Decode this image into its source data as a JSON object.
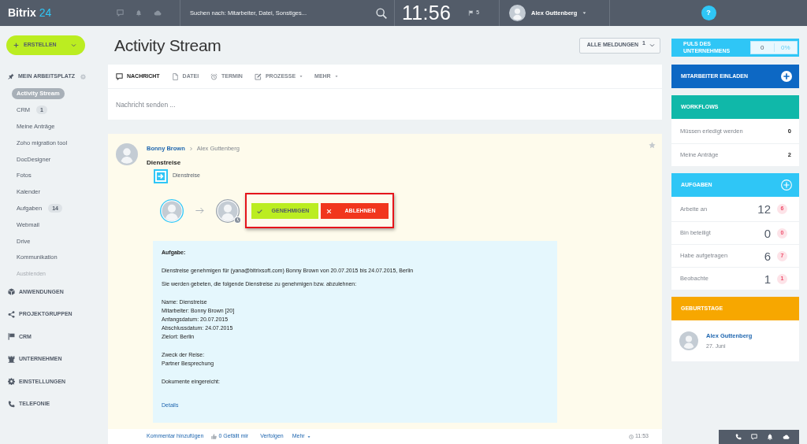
{
  "top_bar": {
    "logo": {
      "word": "Bitrix",
      "number": "24"
    },
    "search": {
      "placeholder": "Suchen nach: Mitarbeiter, Datei, Sonstiges..."
    },
    "clock": "11:56",
    "flag_count": "5",
    "user": "Alex Guttenberg",
    "help": "?"
  },
  "sidebar": {
    "create_button": "ERSTELLEN",
    "section": "MEIN ARBEITSPLATZ",
    "items": [
      {
        "label": "Activity Stream",
        "selected": true
      },
      {
        "label": "CRM",
        "selected": false,
        "count": "1"
      },
      {
        "label": "Meine Anträge",
        "selected": false
      },
      {
        "label": "Zoho migration tool",
        "selected": false
      },
      {
        "label": "DocDesigner",
        "selected": false
      },
      {
        "label": "Fotos",
        "selected": false
      },
      {
        "label": "Kalender",
        "selected": false
      },
      {
        "label": "Aufgaben",
        "selected": false,
        "count": "14"
      },
      {
        "label": "Webmail",
        "selected": false
      },
      {
        "label": "Drive",
        "selected": false
      },
      {
        "label": "Kommunikation",
        "selected": false
      }
    ],
    "hide_link": "Ausblenden",
    "groups": [
      "ANWENDUNGEN",
      "PROJEKTGRUPPEN",
      "CRM",
      "UNTERNEHMEN",
      "EINSTELLUNGEN",
      "TELEFONIE"
    ]
  },
  "main": {
    "title": "Activity Stream",
    "filter_button": "ALLE MELDUNGEN$^{1}$",
    "composer": {
      "tabs": [
        {
          "label": "NACHRICHT",
          "selected": true,
          "dropdown": false
        },
        {
          "label": "DATEI",
          "selected": false,
          "dropdown": false
        },
        {
          "label": "TERMIN",
          "selected": false,
          "dropdown": false
        },
        {
          "label": "PROZESSE",
          "selected": false,
          "dropdown": true
        },
        {
          "label": "MEHR",
          "selected": false,
          "dropdown": true
        }
      ],
      "placeholder": "Nachricht senden ..."
    }
  },
  "post": {
    "author": "Bonny Brown",
    "recipient": "Alex Guttenberg",
    "title": "Dienstreise",
    "workflow": "Dienstreise",
    "actions_highlighted": true,
    "actions": [
      {
        "label": "GENEHMIGEN",
        "kind": "approve"
      },
      {
        "label": "ABLEHNEN",
        "kind": "reject"
      }
    ],
    "task": {
      "heading": "Aufgabe:",
      "blocks": [
        [
          "Dienstreise genehmigen für (yana@bitrixsoft.com) Bonny Brown von 20.07.2015 bis 24.07.2015, Berlin"
        ],
        [
          "Sie werden gebeten, die folgende Dienstreise zu genehmigen bzw. abzulehnen:"
        ],
        [
          "Name: Dienstreise",
          "Mitarbeiter: Bonny Brown [20]",
          "Anfangsdatum: 20.07.2015",
          "Abschlussdatum: 24.07.2015",
          "Zielort: Berlin"
        ],
        [
          "Zweck der Reise:",
          "Partner Besprechung"
        ],
        [
          "Dokumente eingereicht:"
        ]
      ],
      "link": "Details"
    },
    "footer": {
      "comment": "Kommentar hinzufügen",
      "likes": "0 Gefällt mir",
      "follow": "Verfolgen",
      "more": "Mehr",
      "time": "11:53"
    }
  },
  "right": {
    "pulse": {
      "label": "PULS DES UNTERNEHMENS",
      "count": "0",
      "percent": "0%"
    },
    "invite": "MITARBEITER EINLADEN",
    "workflows": {
      "title": "WORKFLOWS",
      "rows": [
        {
          "label": "Müssen erledigt werden",
          "count": "0"
        },
        {
          "label": "Meine Anträge",
          "count": "2"
        }
      ]
    },
    "tasks": {
      "title": "AUFGABEN",
      "rows": [
        {
          "label": "Arbeite an",
          "count": "12",
          "badge": "6"
        },
        {
          "label": "Bin beteiligt",
          "count": "0",
          "badge": "0"
        },
        {
          "label": "Habe aufgetragen",
          "count": "6",
          "badge": "7"
        },
        {
          "label": "Beobachte",
          "count": "1",
          "badge": "1"
        }
      ]
    },
    "birthdays": {
      "title": "GEBURTSTAGE",
      "people": [
        {
          "name": "Alex Guttenberg",
          "date": "27. Juni"
        }
      ]
    }
  }
}
